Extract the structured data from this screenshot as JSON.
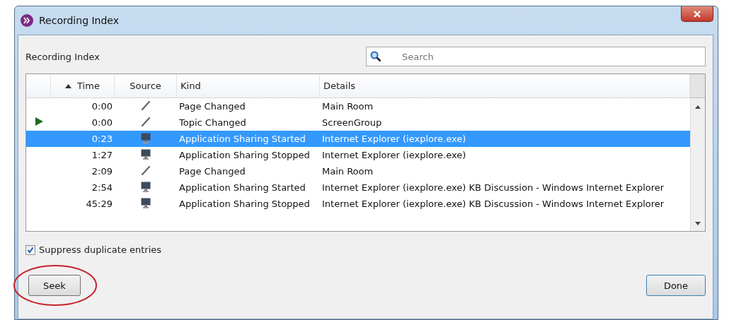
{
  "window": {
    "title": "Recording Index"
  },
  "panel": {
    "label": "Recording Index"
  },
  "search": {
    "placeholder": "Search"
  },
  "table": {
    "columns": [
      {
        "label": "Time",
        "sorted": true
      },
      {
        "label": "Source",
        "sorted": false
      },
      {
        "label": "Kind",
        "sorted": false
      },
      {
        "label": "Details",
        "sorted": false
      }
    ],
    "rows": [
      {
        "current": false,
        "selected": false,
        "time": "0:00",
        "source": {
          "kind": "pen"
        },
        "kind": "Page Changed",
        "details": "Main Room"
      },
      {
        "current": true,
        "selected": false,
        "time": "0:00",
        "source": {
          "kind": "pen"
        },
        "kind": "Topic Changed",
        "details": "ScreenGroup"
      },
      {
        "current": false,
        "selected": true,
        "time": "0:23",
        "source": {
          "kind": "monitor"
        },
        "kind": "Application Sharing Started",
        "details": "Internet Explorer (iexplore.exe)"
      },
      {
        "current": false,
        "selected": false,
        "time": "1:27",
        "source": {
          "kind": "monitor"
        },
        "kind": "Application Sharing Stopped",
        "details": "Internet Explorer (iexplore.exe)"
      },
      {
        "current": false,
        "selected": false,
        "time": "2:09",
        "source": {
          "kind": "pen"
        },
        "kind": "Page Changed",
        "details": "Main Room"
      },
      {
        "current": false,
        "selected": false,
        "time": "2:54",
        "source": {
          "kind": "monitor"
        },
        "kind": "Application Sharing Started",
        "details": "Internet Explorer (iexplore.exe) KB Discussion - Windows Internet Explorer"
      },
      {
        "current": false,
        "selected": false,
        "time": "45:29",
        "source": {
          "kind": "monitor"
        },
        "kind": "Application Sharing Stopped",
        "details": "Internet Explorer (iexplore.exe) KB Discussion - Windows Internet Explorer"
      }
    ]
  },
  "suppress_duplicates": {
    "label": "Suppress duplicate entries",
    "checked": true
  },
  "buttons": [
    {
      "label": "Seek",
      "circled": true
    },
    {
      "label": "Done",
      "circled": false
    }
  ]
}
